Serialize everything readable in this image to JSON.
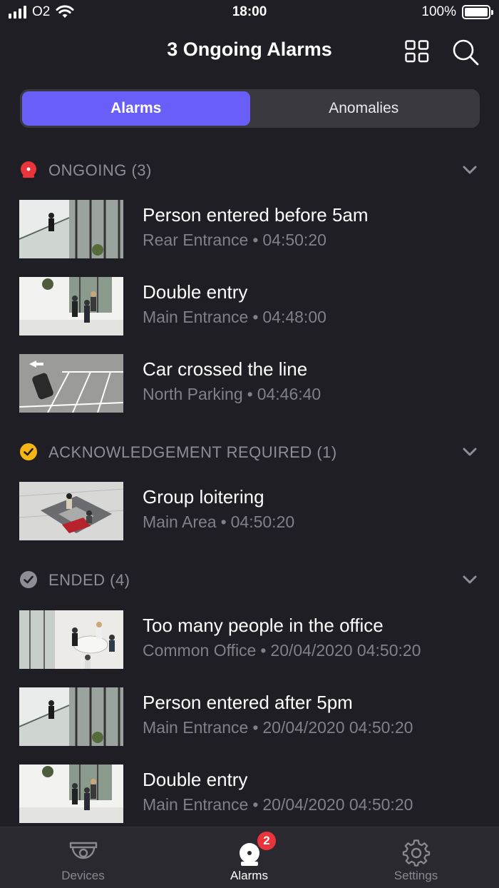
{
  "status_bar": {
    "carrier": "O2",
    "time": "18:00",
    "battery": "100%"
  },
  "header": {
    "title": "3 Ongoing Alarms",
    "icons": [
      "grid-view-icon",
      "search-icon"
    ]
  },
  "segments": [
    {
      "label": "Alarms",
      "active": true
    },
    {
      "label": "Anomalies",
      "active": false
    }
  ],
  "sections": [
    {
      "label": "ONGOING (3)",
      "icon": "alarm-red-icon",
      "color": "#e8343a",
      "items": [
        {
          "title": "Person entered before 5am",
          "location": "Rear Entrance",
          "time": "04:50:20",
          "thumb": "stairs"
        },
        {
          "title": "Double entry",
          "location": "Main Entrance",
          "time": "04:48:00",
          "thumb": "entrance"
        },
        {
          "title": "Car crossed the line",
          "location": "North Parking",
          "time": "04:46:40",
          "thumb": "parking"
        }
      ]
    },
    {
      "label": "ACKNOWLEDGEMENT REQUIRED (1)",
      "icon": "check-yellow-icon",
      "color": "#f5b614",
      "items": [
        {
          "title": "Group loitering",
          "location": "Main Area",
          "time": "04:50:20",
          "thumb": "lounge"
        }
      ]
    },
    {
      "label": "ENDED (4)",
      "icon": "check-grey-icon",
      "color": "#8e8d95",
      "items": [
        {
          "title": "Too many people in the office",
          "location": "Common Office",
          "time": "20/04/2020 04:50:20",
          "thumb": "office"
        },
        {
          "title": "Person entered after 5pm",
          "location": "Main Entrance",
          "time": "20/04/2020 04:50:20",
          "thumb": "stairs"
        },
        {
          "title": "Double entry",
          "location": "Main Entrance",
          "time": "20/04/2020 04:50:20",
          "thumb": "entrance"
        }
      ]
    }
  ],
  "tab_bar": {
    "tabs": [
      {
        "label": "Devices",
        "icon": "camera-dome-icon",
        "active": false
      },
      {
        "label": "Alarms",
        "icon": "alarm-bell-icon",
        "active": true,
        "badge": "2"
      },
      {
        "label": "Settings",
        "icon": "gear-icon",
        "active": false
      }
    ]
  },
  "colors": {
    "accent": "#6a5ef9",
    "background": "#1f1e25",
    "badge": "#e8343a"
  }
}
